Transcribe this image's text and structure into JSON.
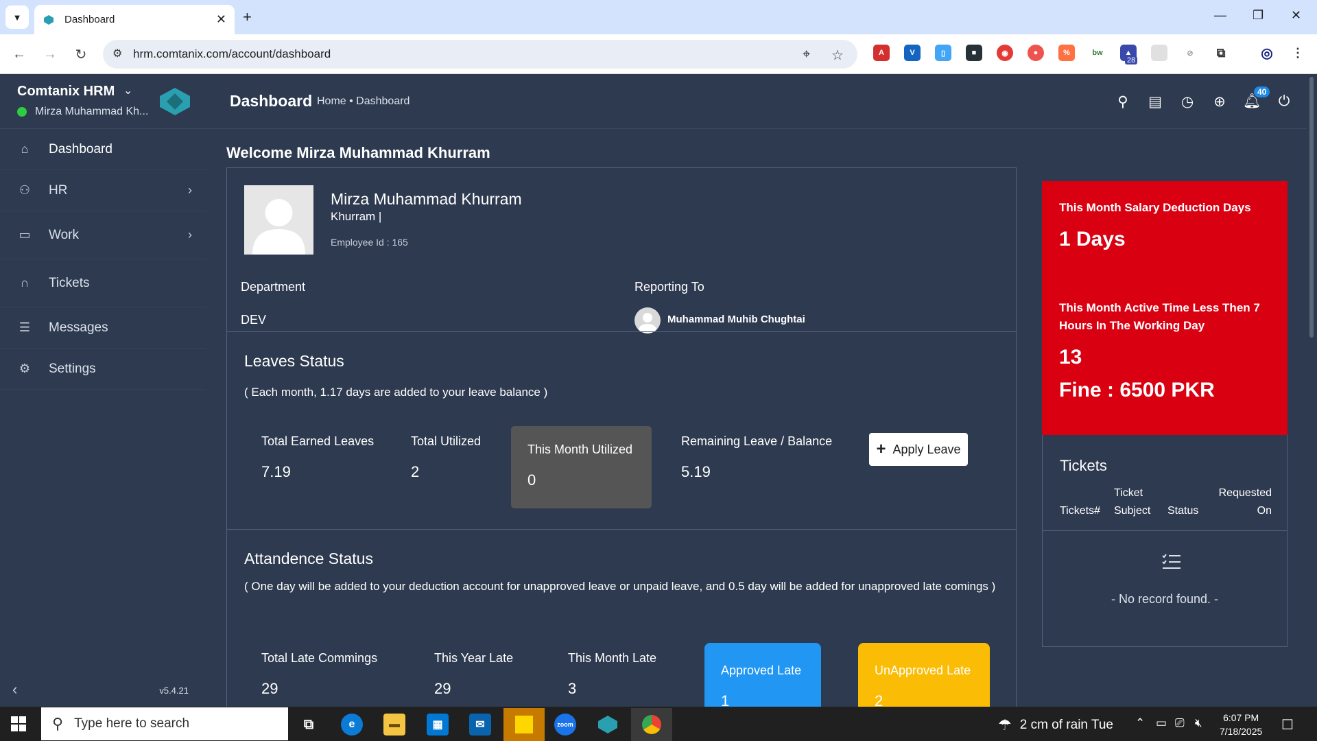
{
  "browser": {
    "tab_title": "Dashboard",
    "url": "hrm.comtanix.com/account/dashboard",
    "extension_badge": "28"
  },
  "sidebar": {
    "app_name": "Comtanix HRM",
    "user": "Mirza Muhammad Kh...",
    "version": "v5.4.21",
    "items": [
      {
        "label": "Dashboard",
        "icon": "home-icon"
      },
      {
        "label": "HR",
        "icon": "users-icon"
      },
      {
        "label": "Work",
        "icon": "briefcase-icon"
      },
      {
        "label": "Tickets",
        "icon": "headset-icon"
      },
      {
        "label": "Messages",
        "icon": "message-icon"
      },
      {
        "label": "Settings",
        "icon": "gear-icon"
      }
    ]
  },
  "header": {
    "title": "Dashboard",
    "breadcrumb": "Home • Dashboard",
    "notification_count": "40"
  },
  "welcome": "Welcome Mirza Muhammad Khurram",
  "profile": {
    "name": "Mirza Muhammad Khurram",
    "subtitle": "Khurram |",
    "employee_id": "Employee Id : 165",
    "department_label": "Department",
    "department": "DEV",
    "reporting_label": "Reporting To",
    "reporting_to": "Muhammad Muhib Chughtai"
  },
  "leaves": {
    "title": "Leaves Status",
    "note": "( Each month, 1.17 days are added to your leave balance )",
    "total_earned_label": "Total Earned Leaves",
    "total_earned": "7.19",
    "total_utilized_label": "Total Utilized",
    "total_utilized": "2",
    "month_utilized_label": "This Month Utilized",
    "month_utilized": "0",
    "remaining_label": "Remaining Leave / Balance",
    "remaining": "5.19",
    "apply_label": "Apply Leave"
  },
  "attendance": {
    "title": "Attandence Status",
    "note": "( One day will be added to your deduction account for unapproved leave or unpaid leave, and 0.5 day will be added for unapproved late comings )",
    "total_late_label": "Total Late Commings",
    "total_late": "29",
    "year_late_label": "This Year Late",
    "year_late": "29",
    "month_late_label": "This Month Late",
    "month_late": "3",
    "approved_label": "Approved Late",
    "approved": "1",
    "unapproved_label": "UnApproved Late",
    "unapproved": "2"
  },
  "deduction": {
    "days_label": "This Month Salary Deduction Days",
    "days": "1 Days",
    "active_label": "This Month Active Time Less Then 7 Hours In The Working Day",
    "active": "13",
    "fine": "Fine : 6500 PKR"
  },
  "tickets": {
    "title": "Tickets",
    "col1": "Tickets#",
    "col2a": "Ticket",
    "col2b": "Subject",
    "col3": "Status",
    "col4a": "Requested",
    "col4b": "On",
    "empty": "- No record found. -"
  },
  "taskbar": {
    "search_placeholder": "Type here to search",
    "weather": "2 cm of rain Tue",
    "time": "6:07 PM",
    "date": "7/18/2025"
  },
  "colors": {
    "sidebar_bg": "#2d3a4f",
    "deduction_bg": "#d90012",
    "approved_bg": "#2196f3",
    "unapproved_bg": "#fbbc05"
  }
}
